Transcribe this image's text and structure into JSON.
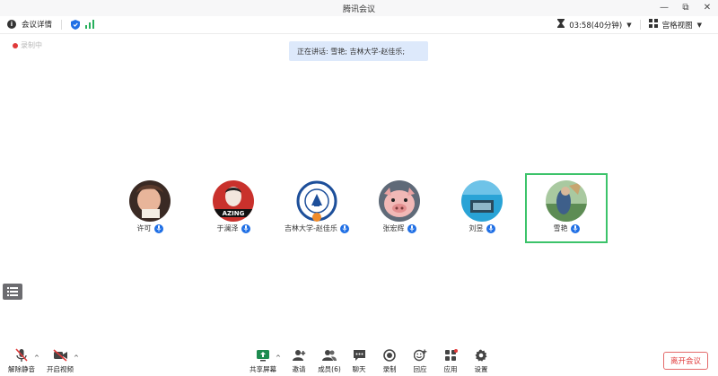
{
  "window": {
    "title": "腾讯会议"
  },
  "infobar": {
    "details_label": "会议详情",
    "timer": "03:58(40分钟)",
    "view_label": "宫格视图"
  },
  "recording_label": "录制中",
  "speaking_banner": "正在讲话: 雪艳; 吉林大学-赵佳乐;",
  "participants": [
    {
      "name": "许可"
    },
    {
      "name": "于澜泽"
    },
    {
      "name": "吉林大学-赵佳乐"
    },
    {
      "name": "张宏辉"
    },
    {
      "name": "刘昱"
    },
    {
      "name": "雪艳"
    }
  ],
  "toolbar": {
    "mute": "解除静音",
    "video": "开启视频",
    "share": "共享屏幕",
    "invite": "邀请",
    "members": "成员(6)",
    "chat": "聊天",
    "record": "录制",
    "replay": "回应",
    "apps": "应用",
    "settings": "设置",
    "leave": "离开会议"
  },
  "colors": {
    "accent": "#1f6fe5",
    "active_border": "#3cc36a",
    "leave": "#e03a3a"
  }
}
